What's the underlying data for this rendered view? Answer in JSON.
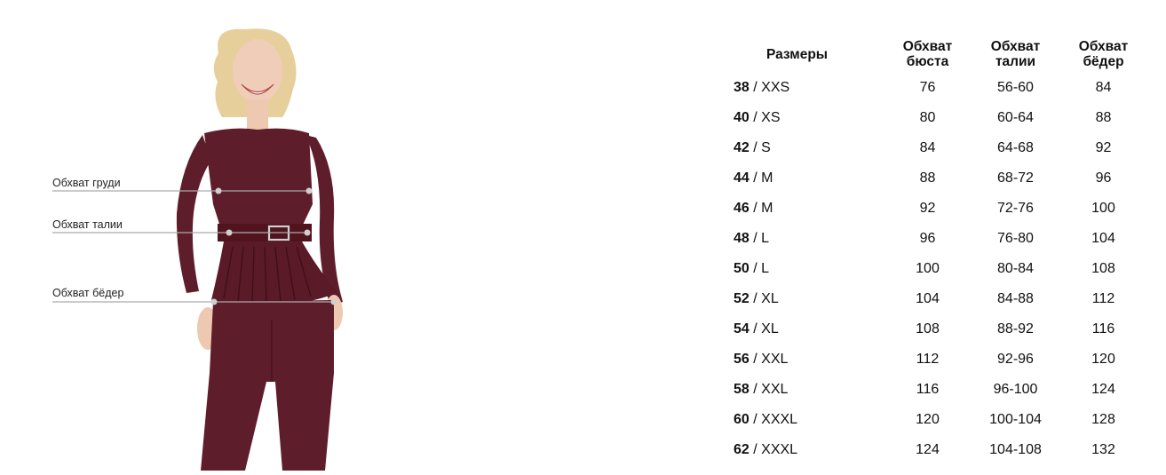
{
  "figure": {
    "labels": {
      "bust": "Обхват груди",
      "waist": "Обхват талии",
      "hips": "Обхват бёдер"
    },
    "colors": {
      "garment": "#5e1d2a",
      "guide_line": "#aaaaaa",
      "hair": "#e6cf9b"
    }
  },
  "table": {
    "headers": {
      "size": "Размеры",
      "bust": "Обхват бюста",
      "waist": "Обхват талии",
      "hips": "Обхват бёдер"
    },
    "rows": [
      {
        "num": "38",
        "sep": " / ",
        "letter": "XXS",
        "bust": "76",
        "waist": "56-60",
        "hips": "84"
      },
      {
        "num": "40",
        "sep": " / ",
        "letter": "XS",
        "bust": "80",
        "waist": "60-64",
        "hips": "88"
      },
      {
        "num": "42",
        "sep": " / ",
        "letter": "S",
        "bust": "84",
        "waist": "64-68",
        "hips": "92"
      },
      {
        "num": "44",
        "sep": " / ",
        "letter": "M",
        "bust": "88",
        "waist": "68-72",
        "hips": "96"
      },
      {
        "num": "46",
        "sep": " / ",
        "letter": "M",
        "bust": "92",
        "waist": "72-76",
        "hips": "100"
      },
      {
        "num": "48",
        "sep": " / ",
        "letter": "L",
        "bust": "96",
        "waist": "76-80",
        "hips": "104"
      },
      {
        "num": "50",
        "sep": " / ",
        "letter": "L",
        "bust": "100",
        "waist": "80-84",
        "hips": "108"
      },
      {
        "num": "52",
        "sep": " / ",
        "letter": "XL",
        "bust": "104",
        "waist": "84-88",
        "hips": "112"
      },
      {
        "num": "54",
        "sep": " / ",
        "letter": "XL",
        "bust": "108",
        "waist": "88-92",
        "hips": "116"
      },
      {
        "num": "56",
        "sep": " / ",
        "letter": "XXL",
        "bust": "112",
        "waist": "92-96",
        "hips": "120"
      },
      {
        "num": "58",
        "sep": " / ",
        "letter": "XXL",
        "bust": "116",
        "waist": "96-100",
        "hips": "124"
      },
      {
        "num": "60",
        "sep": " / ",
        "letter": "XXXL",
        "bust": "120",
        "waist": "100-104",
        "hips": "128"
      },
      {
        "num": "62",
        "sep": " / ",
        "letter": "XXXL",
        "bust": "124",
        "waist": "104-108",
        "hips": "132"
      }
    ]
  }
}
